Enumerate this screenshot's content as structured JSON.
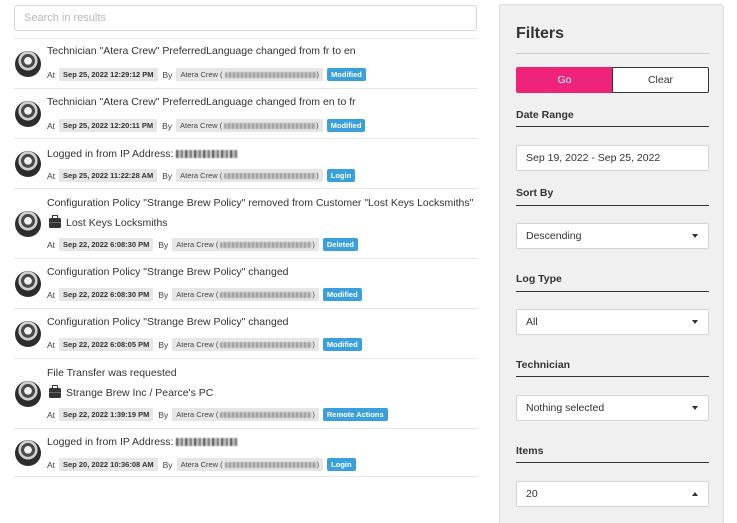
{
  "search": {
    "placeholder": "Search in results",
    "value": ""
  },
  "labels": {
    "at": "At",
    "by": "By"
  },
  "colors": {
    "modified": "#3aa0dc",
    "login": "#3aa0dc",
    "deleted": "#3aa0dc",
    "remote": "#3aa0dc",
    "go": "#f0237a"
  },
  "entries": [
    {
      "title": "Technician \"Atera Crew\" PreferredLanguage changed from fr to en",
      "sub": "",
      "date": "Sep 25, 2022 12:29:12 PM",
      "tech": "Atera Crew (",
      "badge": "Modified"
    },
    {
      "title": "Technician \"Atera Crew\" PreferredLanguage changed from en to fr",
      "sub": "",
      "date": "Sep 25, 2022 12:20:11 PM",
      "tech": "Atera Crew (",
      "badge": "Modified"
    },
    {
      "title": "Logged in from IP Address:",
      "sub": "",
      "date": "Sep 25, 2022 11:22:28 AM",
      "tech": "Atera Crew (",
      "badge": "Login"
    },
    {
      "title": "Configuration Policy \"Strange Brew Policy\" removed from Customer \"Lost Keys Locksmiths\"",
      "sub": "Lost Keys Locksmiths",
      "date": "Sep 22, 2022 6:08:30 PM",
      "tech": "Atera Crew (",
      "badge": "Deleted"
    },
    {
      "title": "Configuration Policy \"Strange Brew Policy\" changed",
      "sub": "",
      "date": "Sep 22, 2022 6:08:30 PM",
      "tech": "Atera Crew (",
      "badge": "Modified"
    },
    {
      "title": "Configuration Policy \"Strange Brew Policy\" changed",
      "sub": "",
      "date": "Sep 22, 2022 6:08:05 PM",
      "tech": "Atera Crew (",
      "badge": "Modified"
    },
    {
      "title": "File Transfer was requested",
      "sub": "Strange Brew Inc / Pearce's PC",
      "date": "Sep 22, 2022 1:39:19 PM",
      "tech": "Atera Crew (",
      "badge": "Remote Actions"
    },
    {
      "title": "Logged in from IP Address:",
      "sub": "",
      "date": "Sep 20, 2022 10:36:08 AM",
      "tech": "Atera Crew (",
      "badge": "Login"
    }
  ],
  "filters": {
    "title": "Filters",
    "go_label": "Go",
    "clear_label": "Clear",
    "date_range": {
      "label": "Date Range",
      "value": "Sep 19, 2022 - Sep 25, 2022"
    },
    "sort_by": {
      "label": "Sort By",
      "value": "Descending"
    },
    "log_type": {
      "label": "Log Type",
      "value": "All"
    },
    "technician": {
      "label": "Technician",
      "value": "Nothing selected"
    },
    "items": {
      "label": "Items",
      "value": "20"
    }
  }
}
